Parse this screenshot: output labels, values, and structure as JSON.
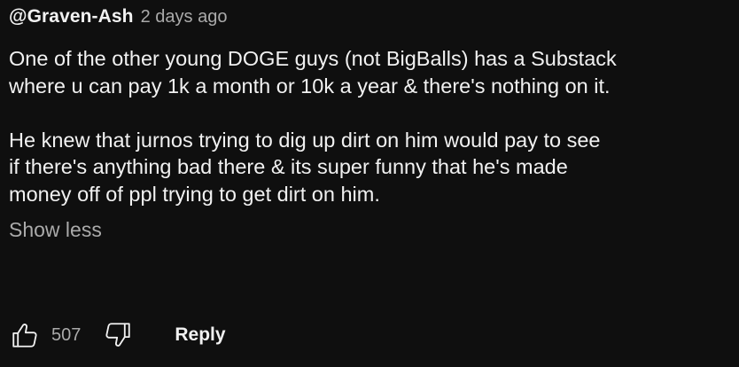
{
  "comment": {
    "author": "@Graven-Ash",
    "timestamp": "2 days ago",
    "paragraphs": [
      {
        "lines": [
          "One of the other young DOGE guys (not BigBalls) has a Substack",
          "where u can pay 1k a month or 10k a year & there's nothing on it."
        ]
      },
      {
        "lines": [
          "He knew that jurnos trying to dig up dirt on him would pay to see",
          "if there's anything bad there & its super funny that he's made",
          "money off of ppl trying to get dirt on him."
        ]
      }
    ],
    "show_less_label": "Show less"
  },
  "actions": {
    "like_icon": "thumbs-up-icon",
    "like_count": "507",
    "dislike_icon": "thumbs-down-icon",
    "reply_label": "Reply"
  },
  "colors": {
    "background": "#0f0f0f",
    "primary_text": "#f1f1f1",
    "secondary_text": "#aaaaaa"
  }
}
